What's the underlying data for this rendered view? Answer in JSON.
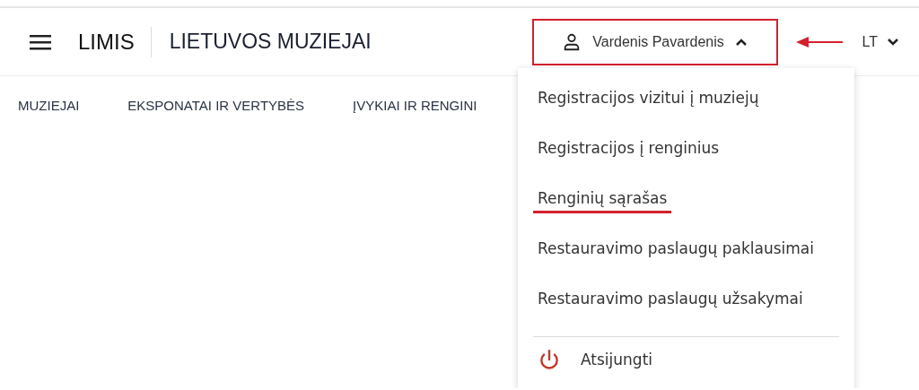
{
  "header": {
    "brand": "LIMIS",
    "title": "LIETUVOS MUZIEJAI"
  },
  "user_button": {
    "label": "Vardenis Pavardenis",
    "expanded": true,
    "highlighted": true
  },
  "language": {
    "label": "LT"
  },
  "nav": [
    "MUZIEJAI",
    "EKSPONATAI IR VERTYBĖS",
    "ĮVYKIAI IR RENGINI"
  ],
  "user_menu": [
    {
      "label": "Registracijos vizitui į muziejų",
      "marked": false
    },
    {
      "label": "Registracijos į renginius",
      "marked": false
    },
    {
      "label": "Renginių sąrašas",
      "marked": true
    },
    {
      "label": "Restauravimo paslaugų paklausimai",
      "marked": false
    },
    {
      "label": "Restauravimo paslaugų užsakymai",
      "marked": false
    }
  ],
  "logout": {
    "label": "Atsijungti"
  }
}
